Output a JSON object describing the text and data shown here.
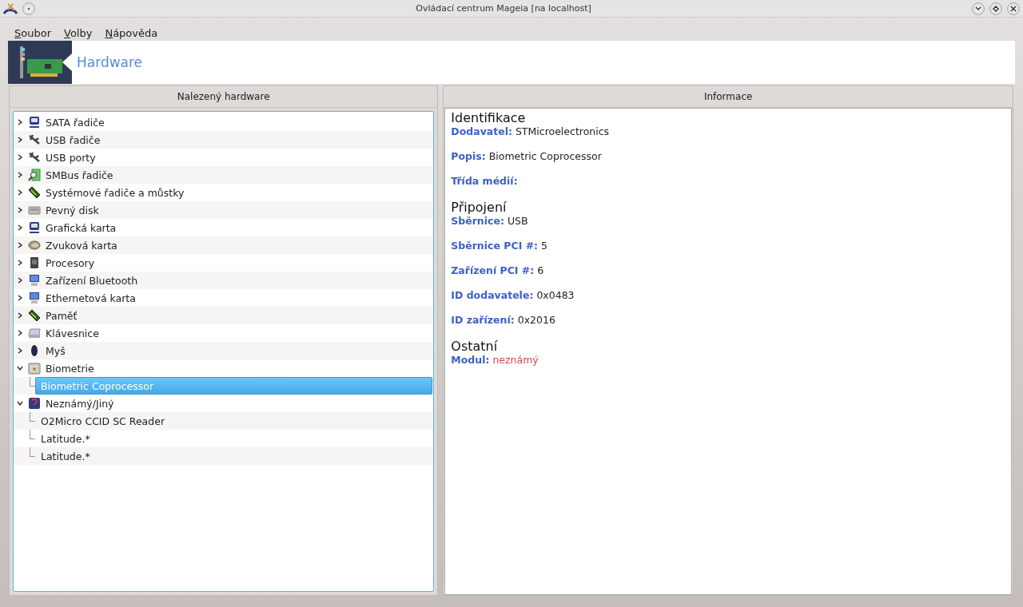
{
  "window": {
    "title": "Ovládací centrum Mageia  [na localhost]"
  },
  "menu": [
    {
      "label": "Soubor"
    },
    {
      "label": "Volby"
    },
    {
      "label": "Nápověda"
    }
  ],
  "banner": {
    "title": "Hardware"
  },
  "tree_panel": {
    "title": "Nalezený hardware",
    "items": [
      {
        "label": "SATA řadiče",
        "expanded": false
      },
      {
        "label": "USB řadiče",
        "expanded": false
      },
      {
        "label": "USB porty",
        "expanded": false
      },
      {
        "label": "SMBus řadiče",
        "expanded": false
      },
      {
        "label": "Systémové řadiče a můstky",
        "expanded": false
      },
      {
        "label": "Pevný disk",
        "expanded": false
      },
      {
        "label": "Grafická karta",
        "expanded": false
      },
      {
        "label": "Zvuková karta",
        "expanded": false
      },
      {
        "label": "Procesory",
        "expanded": false
      },
      {
        "label": "Zařízení Bluetooth",
        "expanded": false
      },
      {
        "label": "Ethernetová karta",
        "expanded": false
      },
      {
        "label": "Paměť",
        "expanded": false
      },
      {
        "label": "Klávesnice",
        "expanded": false
      },
      {
        "label": "Myš",
        "expanded": false
      },
      {
        "label": "Biometrie",
        "expanded": true,
        "children": [
          {
            "label": "Biometric Coprocessor",
            "selected": true
          }
        ]
      },
      {
        "label": "Neznámý/Jiný",
        "expanded": true,
        "children": [
          {
            "label": "O2Micro CCID SC Reader",
            "selected": false
          },
          {
            "label": "Latitude.*",
            "selected": false
          },
          {
            "label": "Latitude.*",
            "selected": false
          }
        ]
      }
    ]
  },
  "info_panel": {
    "title": "Informace",
    "sections": [
      {
        "title": "Identifikace",
        "fields": [
          {
            "label": "Dodavatel:",
            "value": "STMicroelectronics",
            "warning": false
          },
          {
            "label": "Popis:",
            "value": "Biometric Coprocessor",
            "warning": false
          },
          {
            "label": "Třída médií:"
          }
        ]
      },
      {
        "title": "Připojení",
        "fields": [
          {
            "label": "Sběrnice:",
            "value": "USB",
            "warning": false
          },
          {
            "label": "Sběrnice PCI #:",
            "value": "5",
            "warning": false
          },
          {
            "label": "Zařízení PCI #:",
            "value": "6",
            "warning": false
          },
          {
            "label": "ID dodavatele:",
            "value": "0x0483",
            "warning": false
          },
          {
            "label": "ID zařízení:",
            "value": "0x2016",
            "warning": false
          }
        ]
      },
      {
        "title": "Ostatní",
        "fields": [
          {
            "label": "Modul:",
            "value": "neznámý",
            "warning": true
          }
        ]
      }
    ]
  }
}
